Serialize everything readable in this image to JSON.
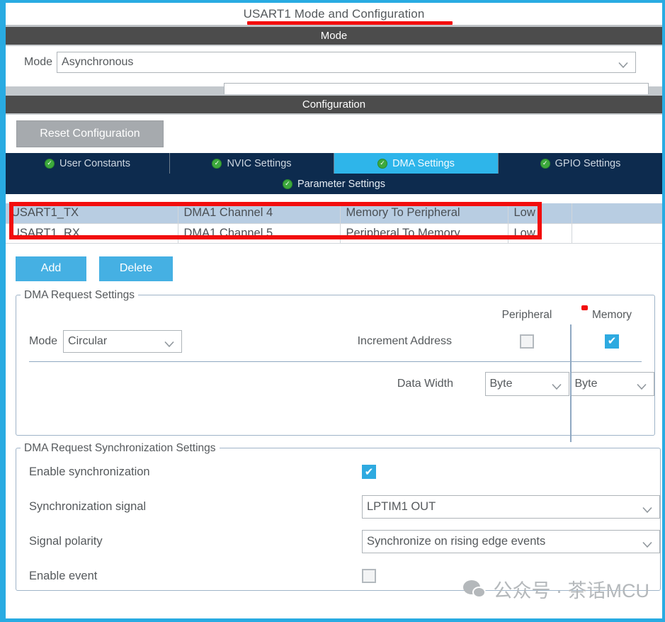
{
  "title": {
    "text": "USART1 Mode and Configuration"
  },
  "mode_section": {
    "header": "Mode",
    "mode_label": "Mode",
    "mode_value": "Asynchronous"
  },
  "configuration_section": {
    "header": "Configuration",
    "reset_button": "Reset Configuration"
  },
  "tabs": [
    {
      "label": "User Constants",
      "icon": "green-check-icon",
      "active": false
    },
    {
      "label": "NVIC Settings",
      "icon": "green-check-icon",
      "active": false
    },
    {
      "label": "DMA Settings",
      "icon": "green-check-icon",
      "active": true
    },
    {
      "label": "GPIO Settings",
      "icon": "green-check-icon",
      "active": false
    }
  ],
  "subtab": {
    "label": "Parameter Settings",
    "icon": "green-check-icon"
  },
  "dma_table": {
    "rows": [
      {
        "request": "USART1_TX",
        "channel": "DMA1 Channel 4",
        "direction": "Memory To Peripheral",
        "priority": "Low",
        "extra": "",
        "selected": true
      },
      {
        "request": "USART1_RX",
        "channel": "DMA1 Channel 5",
        "direction": "Peripheral To Memory",
        "priority": "Low",
        "extra": "",
        "selected": false
      }
    ]
  },
  "table_buttons": {
    "add": "Add",
    "delete": "Delete"
  },
  "request_settings": {
    "legend": "DMA Request Settings",
    "peripheral_header": "Peripheral",
    "memory_header": "Memory",
    "mode_label": "Mode",
    "mode_value": "Circular",
    "increment_address_label": "Increment Address",
    "increment_peripheral_checked": "",
    "increment_memory_checked": "✔",
    "data_width_label": "Data Width",
    "data_width_peripheral": "Byte",
    "data_width_memory": "Byte"
  },
  "sync_settings": {
    "legend": "DMA Request Synchronization Settings",
    "enable_sync_label": "Enable synchronization",
    "enable_sync_checked": "✔",
    "sync_signal_label": "Synchronization signal",
    "sync_signal_value": "LPTIM1 OUT",
    "signal_polarity_label": "Signal polarity",
    "signal_polarity_value": "Synchronize on rising edge events",
    "enable_event_label": "Enable event",
    "enable_event_checked": ""
  },
  "watermark": {
    "text": "公众号 · 茶话MCU",
    "icon": "wechat-icon"
  },
  "colors": {
    "accent_blue": "#29abe2",
    "tab_active": "#2eb5ea",
    "tab_bar": "#0d2b4e",
    "section_header": "#4c4c4c",
    "annotation_red": "#f20d0d",
    "row_selected": "#b8cde2",
    "button_blue": "#45b0e3",
    "check_green": "#3da93d"
  }
}
